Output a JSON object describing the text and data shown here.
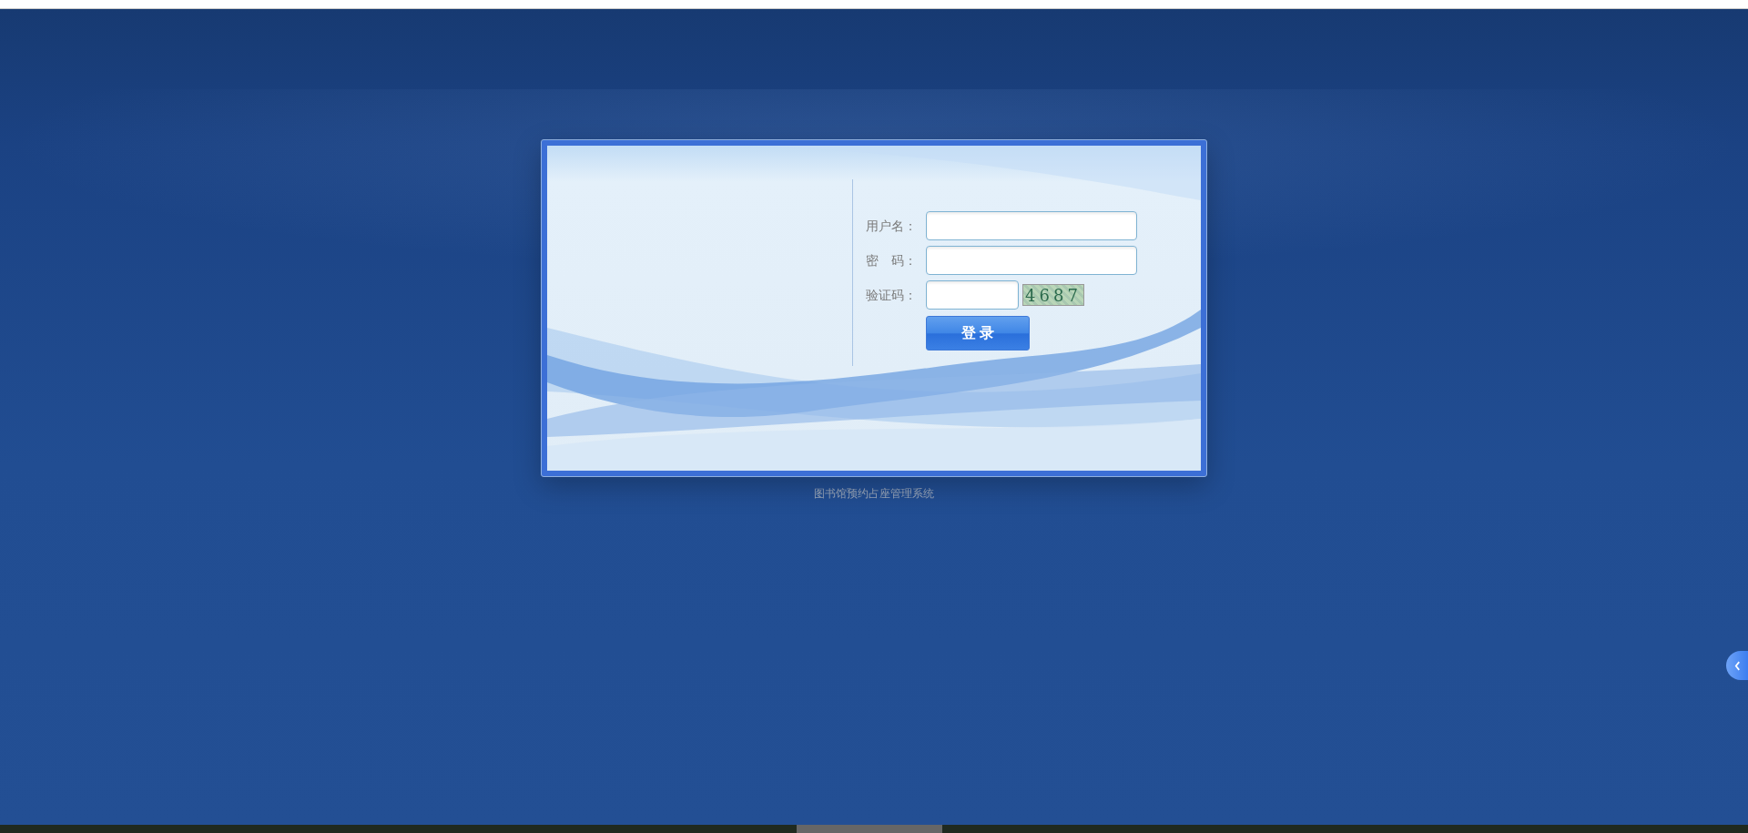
{
  "login_form": {
    "fields": [
      {
        "label": "用户名：",
        "kind": "text"
      },
      {
        "label": "密　码：",
        "kind": "password"
      },
      {
        "label": "验证码：",
        "kind": "captcha"
      }
    ],
    "captcha_code": "4687",
    "submit_button": "登 录"
  },
  "footer": {
    "title": "图书馆预约占座管理系统"
  }
}
